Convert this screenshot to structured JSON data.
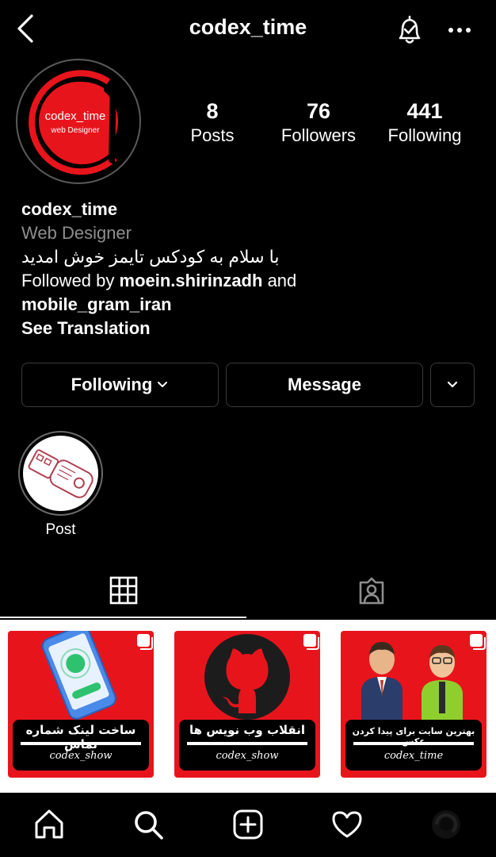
{
  "header": {
    "title": "codex_time",
    "icons": [
      "chevron-left-icon",
      "bell-check-icon",
      "more-icon"
    ]
  },
  "profile": {
    "avatar_text": "codex_time",
    "avatar_subtext": "web Designer",
    "stats": {
      "posts": {
        "value": "8",
        "label": "Posts"
      },
      "followers": {
        "value": "76",
        "label": "Followers"
      },
      "following": {
        "value": "441",
        "label": "Following"
      }
    },
    "username": "codex_time",
    "category": "Web Designer",
    "bio": "با سلام به کودکس تایمز خوش امدید",
    "followed_by_prefix": "Followed by",
    "followed_by_user1": "moein.shirinzadh",
    "followed_by_and": "and",
    "followed_by_user2": "mobile_gram_iran",
    "see_translation": "See Translation"
  },
  "actions": {
    "following_label": "Following",
    "message_label": "Message"
  },
  "highlights": [
    {
      "label": "Post"
    }
  ],
  "tabs": [
    "grid-icon",
    "tagged-icon"
  ],
  "posts": [
    {
      "title": "ساخت لینک شماره تماس",
      "handle": "codex_show"
    },
    {
      "title": "انقلاب وب نویس ها",
      "handle": "codex_show"
    },
    {
      "title": "بهترین سایت برای پیدا کردن عکس",
      "handle": "codex_time"
    }
  ],
  "bottom_nav": [
    "home-icon",
    "search-icon",
    "create-icon",
    "heart-icon",
    "profile-avatar"
  ],
  "colors": {
    "background": "#000000",
    "accent_red": "#e8141c",
    "muted": "#8e8e8e",
    "border": "#3a3a3a"
  }
}
